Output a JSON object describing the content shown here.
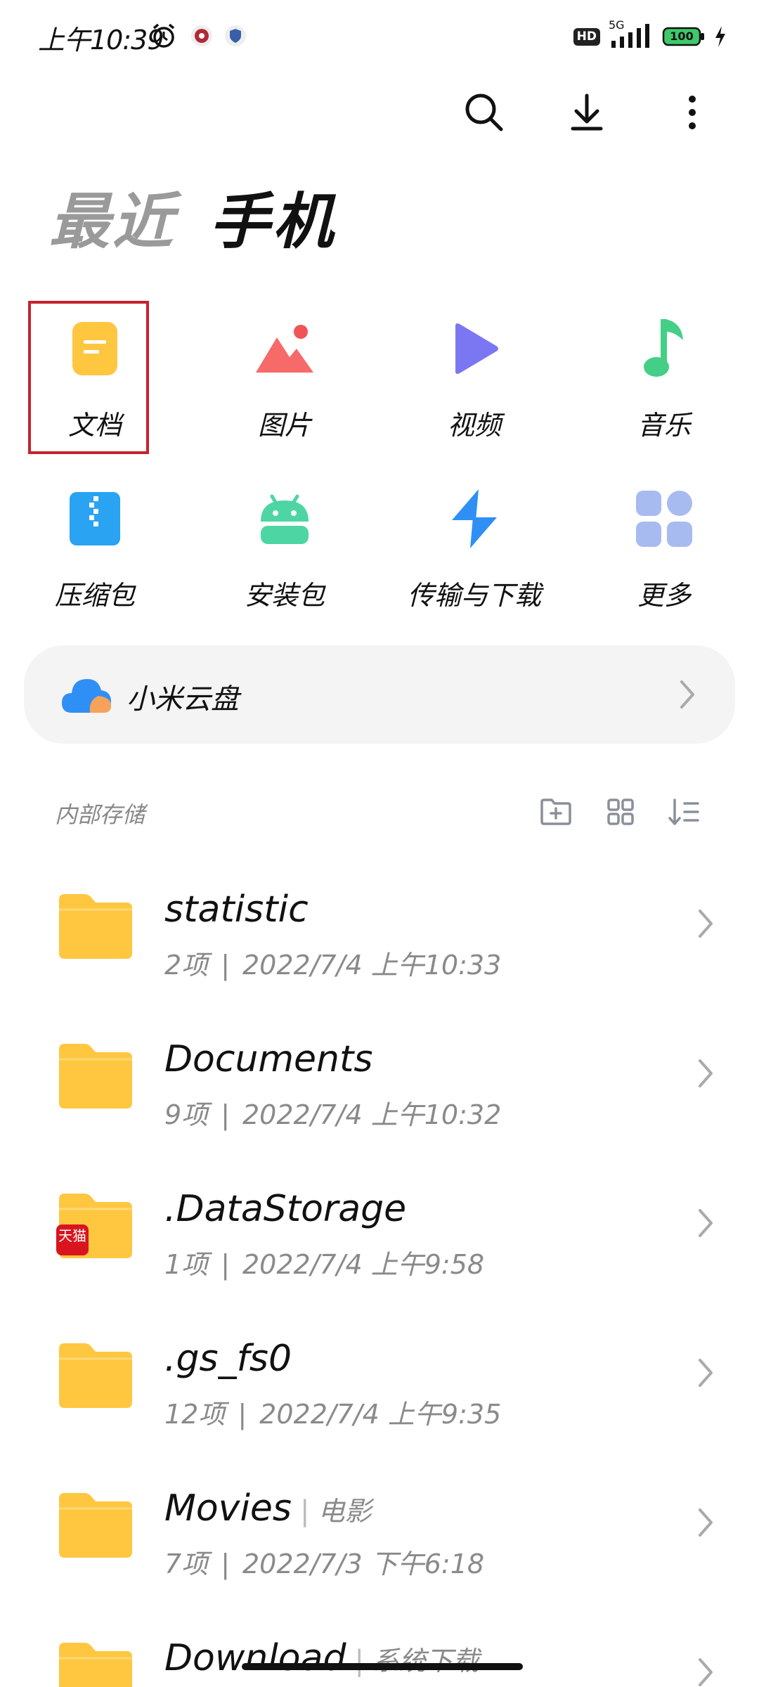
{
  "status_bar": {
    "time": "上午10:39",
    "hd": "HD",
    "network": "5G",
    "battery": "100",
    "icons": [
      "alarm-icon",
      "app-notification-icon",
      "shield-notification-icon",
      "signal-icon",
      "battery-icon",
      "charging-icon"
    ]
  },
  "toolbar": {
    "icons": [
      "search-icon",
      "download-icon",
      "more-icon"
    ]
  },
  "tabs": {
    "recent": "最近",
    "phone": "手机",
    "active": "手机"
  },
  "categories": [
    {
      "label": "文档",
      "icon": "document-icon",
      "color": "#ffc640",
      "selected": true
    },
    {
      "label": "图片",
      "icon": "image-icon",
      "color": "#f66a6a"
    },
    {
      "label": "视频",
      "icon": "video-icon",
      "color": "#7b77f2"
    },
    {
      "label": "音乐",
      "icon": "music-icon",
      "color": "#43cf86"
    },
    {
      "label": "压缩包",
      "icon": "archive-icon",
      "color": "#2aa3f2"
    },
    {
      "label": "安装包",
      "icon": "android-icon",
      "color": "#4dd6a3"
    },
    {
      "label": "传输与下载",
      "icon": "transfer-icon",
      "color": "#2f8ff5"
    },
    {
      "label": "更多",
      "icon": "more-grid-icon",
      "color": "#a8bbf0"
    }
  ],
  "cloud": {
    "label": "小米云盘",
    "icon": "cloud-icon"
  },
  "storage": {
    "title": "内部存储",
    "actions": [
      "new-folder-icon",
      "grid-view-icon",
      "sort-icon"
    ]
  },
  "folders": [
    {
      "name": "statistic",
      "tag": "",
      "count": "2项",
      "date": "2022/7/4 上午10:33",
      "badge": ""
    },
    {
      "name": "Documents",
      "tag": "",
      "count": "9项",
      "date": "2022/7/4 上午10:32",
      "badge": ""
    },
    {
      "name": ".DataStorage",
      "tag": "",
      "count": "1项",
      "date": "2022/7/4 上午9:58",
      "badge": "天猫"
    },
    {
      "name": ".gs_fs0",
      "tag": "",
      "count": "12项",
      "date": "2022/7/4 上午9:35",
      "badge": ""
    },
    {
      "name": "Movies",
      "tag": "电影",
      "count": "7项",
      "date": "2022/7/3 下午6:18",
      "badge": ""
    },
    {
      "name": "Download",
      "tag": "系统下载",
      "count": "",
      "date": "",
      "badge": ""
    }
  ],
  "colors": {
    "folder": "#ffc640",
    "accent_red": "#c4232d",
    "text_primary": "#111111",
    "text_secondary": "#8a8a8a"
  }
}
